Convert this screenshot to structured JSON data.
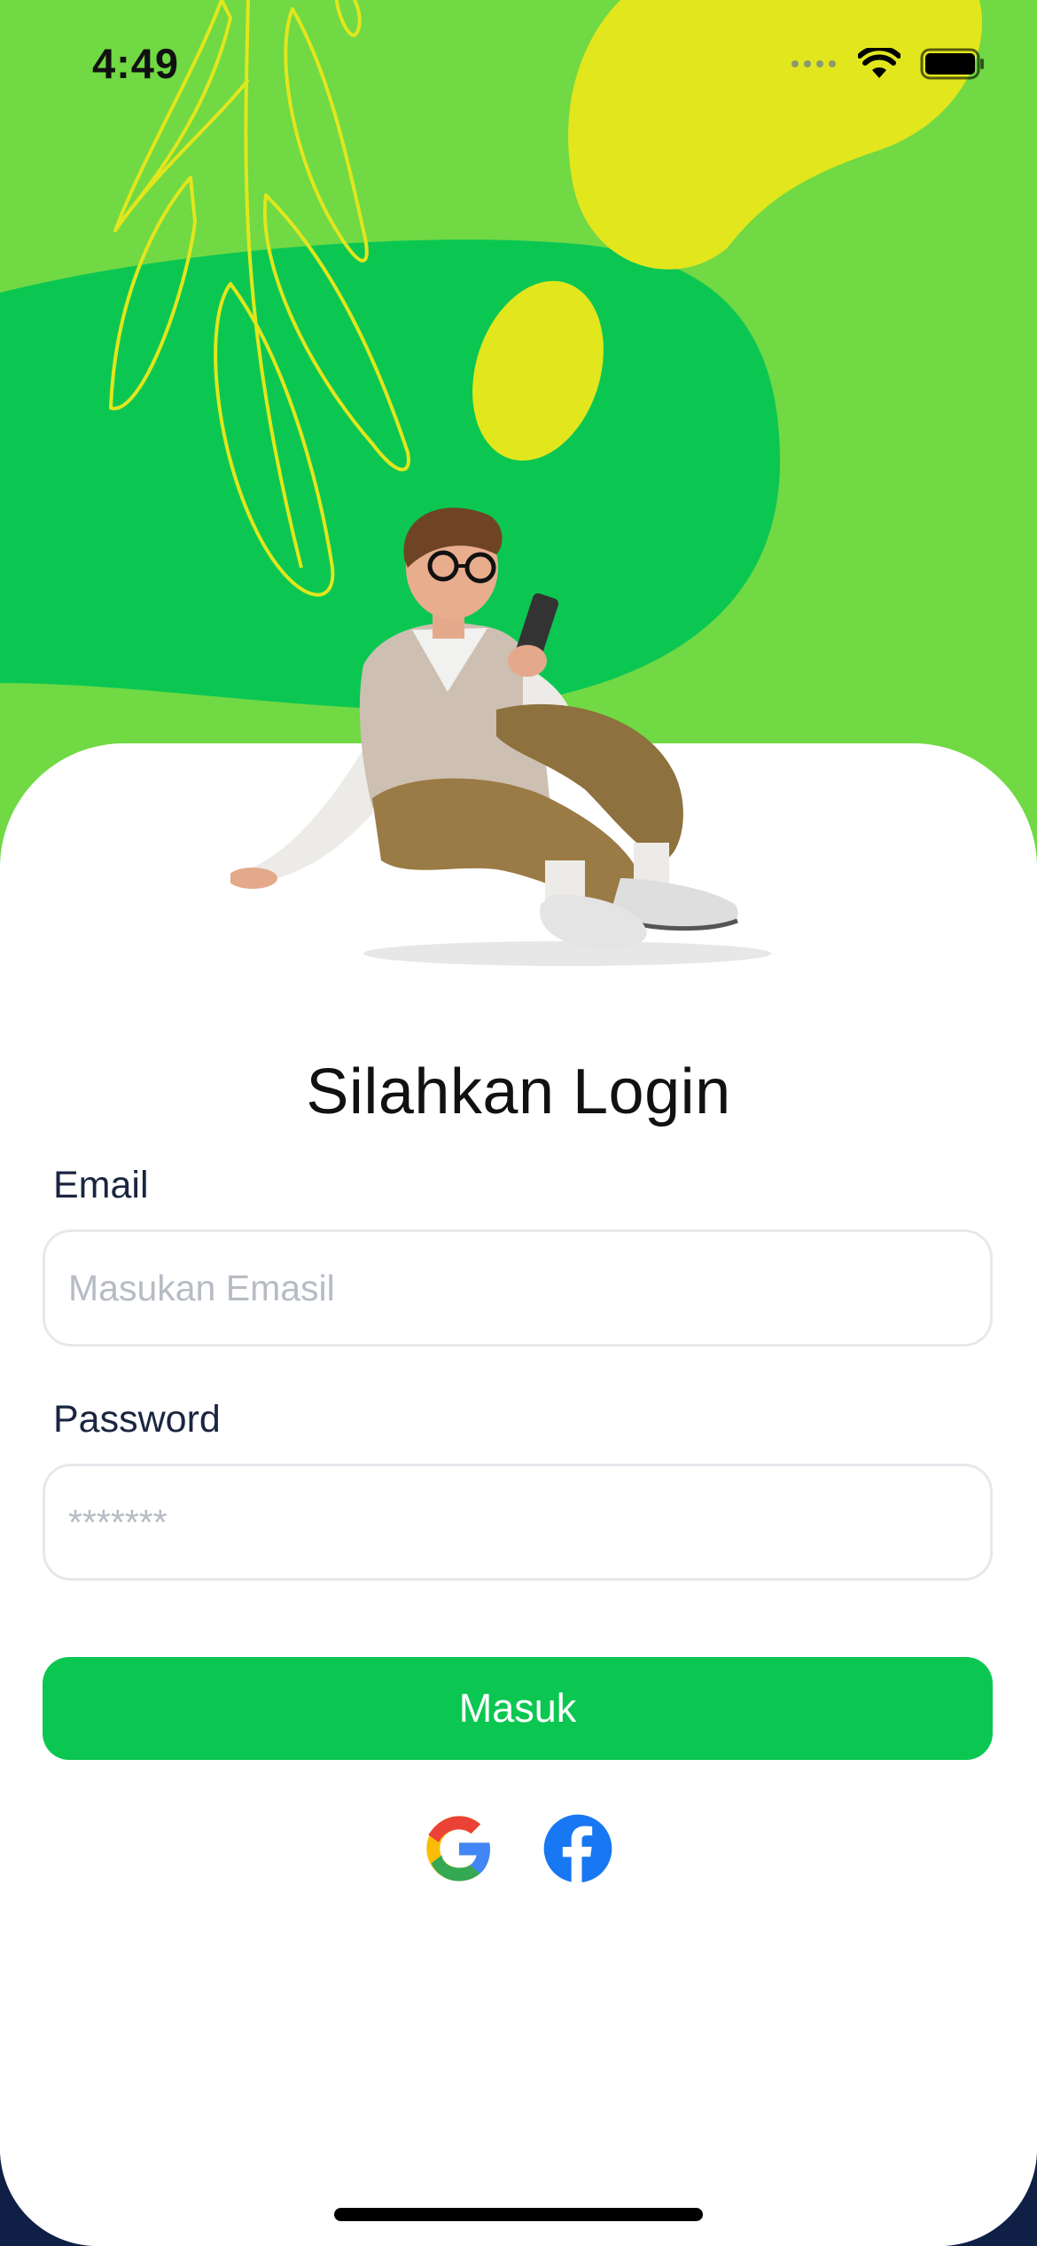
{
  "status_bar": {
    "time": "4:49"
  },
  "login": {
    "title": "Silahkan Login",
    "email_label": "Email",
    "email_placeholder": "Masukan Emasil",
    "password_label": "Password",
    "password_placeholder": "*******",
    "submit_label": "Masuk"
  },
  "social": [
    {
      "icon": "google-icon"
    },
    {
      "icon": "facebook-icon"
    }
  ],
  "colors": {
    "hero_light_green": "#70d944",
    "hero_dark_green": "#0bc752",
    "blob_yellow": "#e2e61c",
    "button_green": "#0bc752",
    "facebook_blue": "#1877f2"
  }
}
